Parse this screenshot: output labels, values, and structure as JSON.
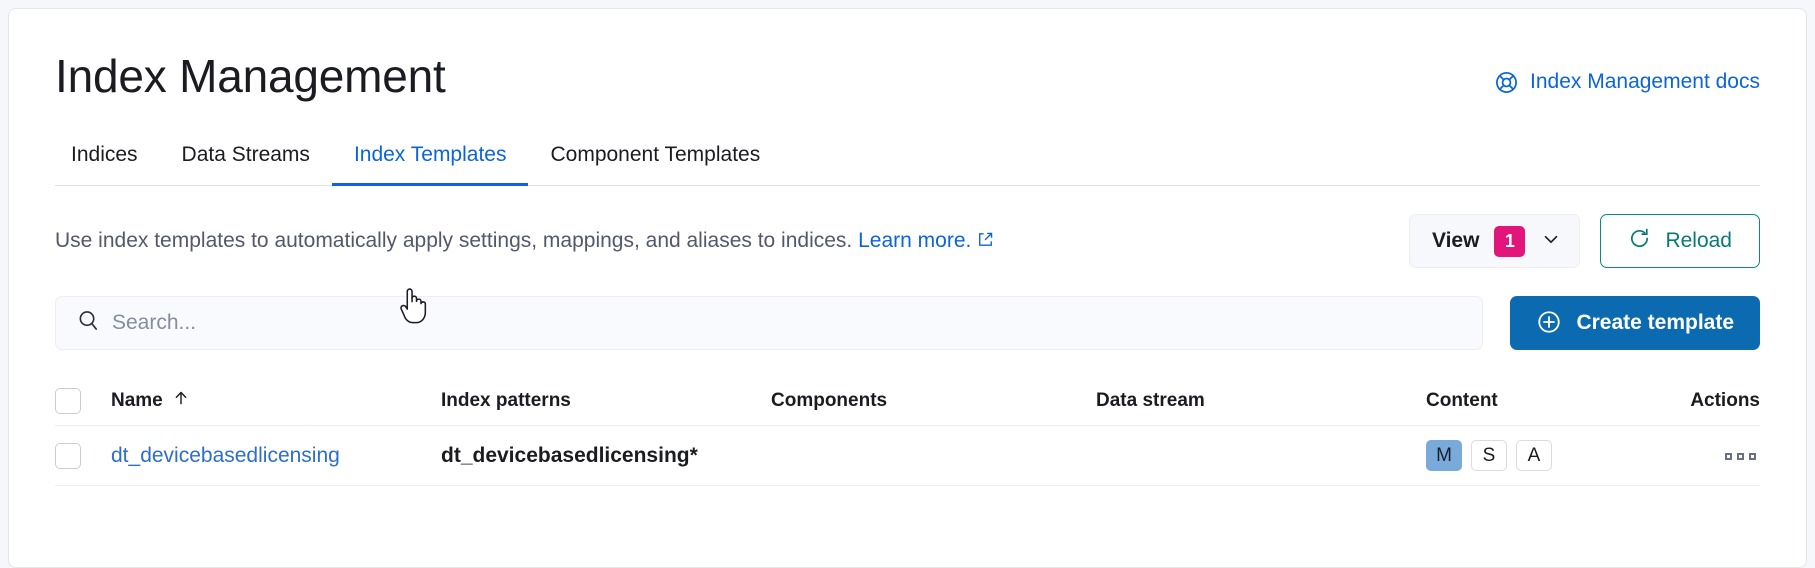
{
  "header": {
    "title": "Index Management",
    "docs_link_label": "Index Management docs",
    "docs_icon": "help-lifering-icon",
    "link_color": "#0b64dd"
  },
  "tabs": [
    {
      "label": "Indices",
      "active": false
    },
    {
      "label": "Data Streams",
      "active": false
    },
    {
      "label": "Index Templates",
      "active": true
    },
    {
      "label": "Component Templates",
      "active": false
    }
  ],
  "description": {
    "text": "Use index templates to automatically apply settings, mappings, and aliases to indices.",
    "learn_more_label": "Learn more.",
    "external_icon": "external-link-icon"
  },
  "toolbar": {
    "view_label": "View",
    "view_badge_count": "1",
    "view_badge_color": "#e2157b",
    "view_chevron_icon": "chevron-down-icon",
    "reload_label": "Reload",
    "reload_icon": "refresh-icon",
    "reload_color": "#077b73"
  },
  "search": {
    "placeholder": "Search...",
    "value": "",
    "icon": "search-icon"
  },
  "create_button": {
    "label": "Create template",
    "icon": "plus-in-circle-icon",
    "color": "#0c6ab0"
  },
  "table": {
    "columns": [
      {
        "key": "name",
        "label": "Name",
        "sort_icon": "arrow-up-icon",
        "sorted": true
      },
      {
        "key": "index_patterns",
        "label": "Index patterns"
      },
      {
        "key": "components",
        "label": "Components"
      },
      {
        "key": "data_stream",
        "label": "Data stream"
      },
      {
        "key": "content",
        "label": "Content"
      },
      {
        "key": "actions",
        "label": "Actions"
      }
    ],
    "rows": [
      {
        "selected": false,
        "name": "dt_devicebasedlicensing",
        "index_patterns": "dt_devicebasedlicensing*",
        "components": "",
        "data_stream": "",
        "content": [
          {
            "label": "M",
            "active": true
          },
          {
            "label": "S",
            "active": false
          },
          {
            "label": "A",
            "active": false
          }
        ],
        "actions_icon": "more-actions-icon"
      }
    ],
    "content_active_color": "#79aad9"
  },
  "cursor": {
    "type": "pointer-hand-cursor"
  }
}
